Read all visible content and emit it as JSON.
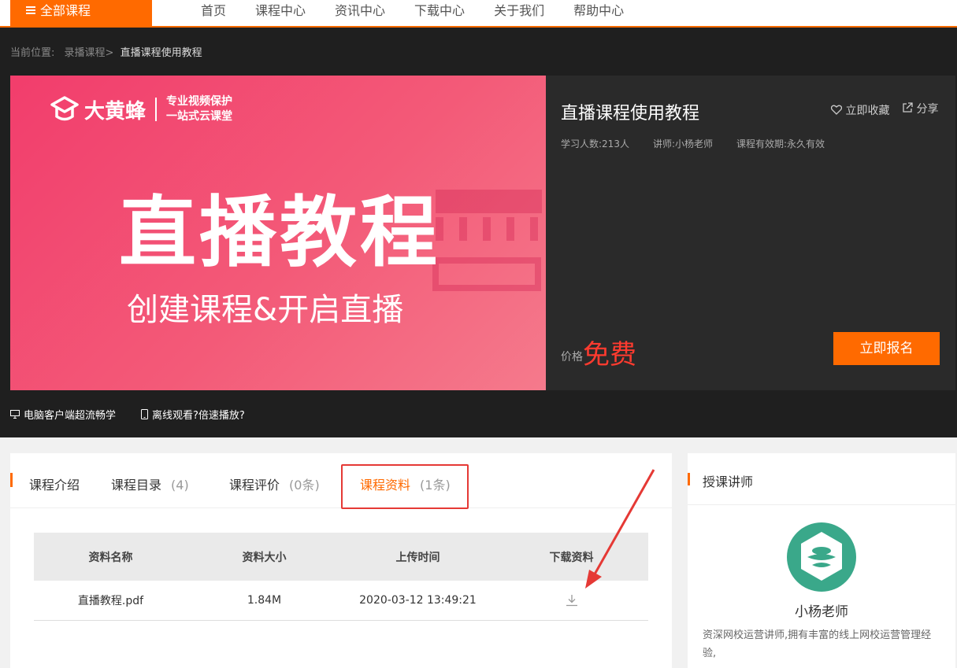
{
  "nav": {
    "all_courses": "全部课程",
    "links": [
      "首页",
      "课程中心",
      "资讯中心",
      "下载中心",
      "关于我们",
      "帮助中心"
    ]
  },
  "breadcrumb": {
    "prefix": "当前位置:",
    "parent": "录播课程",
    "sep": ">",
    "current": "直播课程使用教程"
  },
  "banner": {
    "brand": "大黄蜂",
    "slogan1": "专业视频保护",
    "slogan2": "一站式云课堂",
    "title": "直播教程",
    "subtitle": "创建课程&开启直播"
  },
  "course": {
    "title": "直播课程使用教程",
    "favorite": "立即收藏",
    "share": "分享",
    "students": "学习人数:213人",
    "teacher": "讲师:小杨老师",
    "validity": "课程有效期:永久有效",
    "price_label": "价格",
    "price": "免费",
    "enroll": "立即报名"
  },
  "tips": {
    "desktop": "电脑客户端超流畅学",
    "offline": "离线观看?倍速播放?"
  },
  "tabs": [
    {
      "label": "课程介绍",
      "count": ""
    },
    {
      "label": "课程目录",
      "count": "(4)"
    },
    {
      "label": "课程评价",
      "count": "(0条)"
    },
    {
      "label": "课程资料",
      "count": "(1条)"
    }
  ],
  "materials": {
    "headers": [
      "资料名称",
      "资料大小",
      "上传时间",
      "下载资料"
    ],
    "rows": [
      {
        "name": "直播教程.pdf",
        "size": "1.84M",
        "time": "2020-03-12 13:49:21",
        "download_icon": "download-icon"
      }
    ]
  },
  "instructor": {
    "section_title": "授课讲师",
    "name": "小杨老师",
    "desc": "资深网校运营讲师,拥有丰富的线上网校运营管理经验,"
  },
  "colors": {
    "accent": "#ff6a00",
    "price": "#ff3b2f",
    "highlight_box": "#e53935",
    "avatar": "#3aa88a"
  }
}
